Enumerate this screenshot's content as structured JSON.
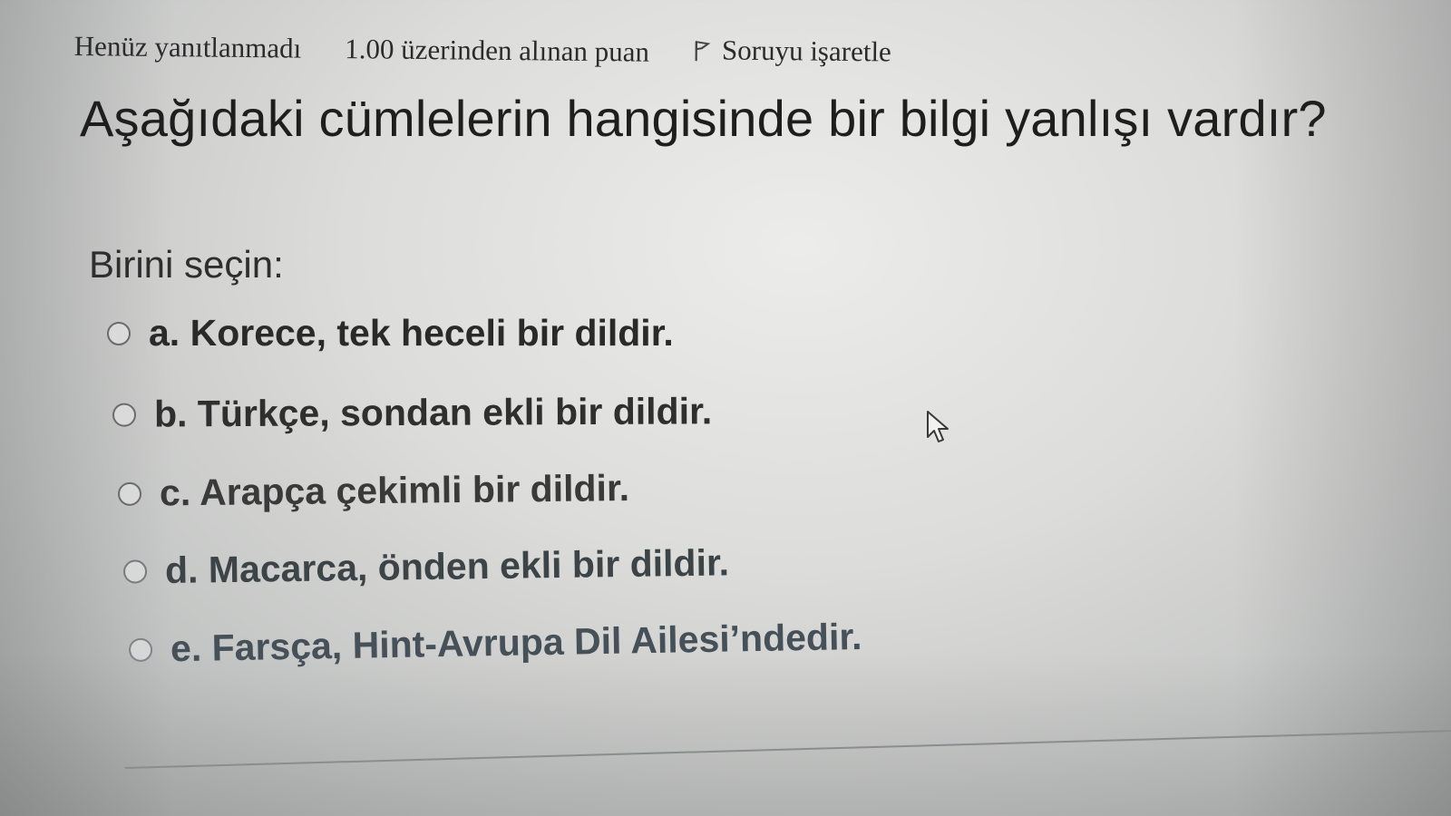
{
  "info_bar": {
    "status": "Henüz yanıtlanmadı",
    "points": "1.00 üzerinden alınan puan",
    "flag_label": "Soruyu işaretle"
  },
  "question": {
    "text": "Aşağıdaki cümlelerin hangisinde bir bilgi yanlışı vardır?",
    "prompt": "Birini seçin:",
    "answers": [
      {
        "label": "a. Korece, tek heceli bir dildir."
      },
      {
        "label": "b. Türkçe, sondan ekli bir dildir."
      },
      {
        "label": "c. Arapça çekimli bir dildir."
      },
      {
        "label": "d. Macarca, önden ekli bir dildir."
      },
      {
        "label": "e. Farsça, Hint-Avrupa Dil Ailesi’ndedir."
      }
    ]
  },
  "icons": {
    "flag": "flag-icon",
    "cursor": "mouse-pointer-icon",
    "radio": "radio-unchecked-icon"
  }
}
